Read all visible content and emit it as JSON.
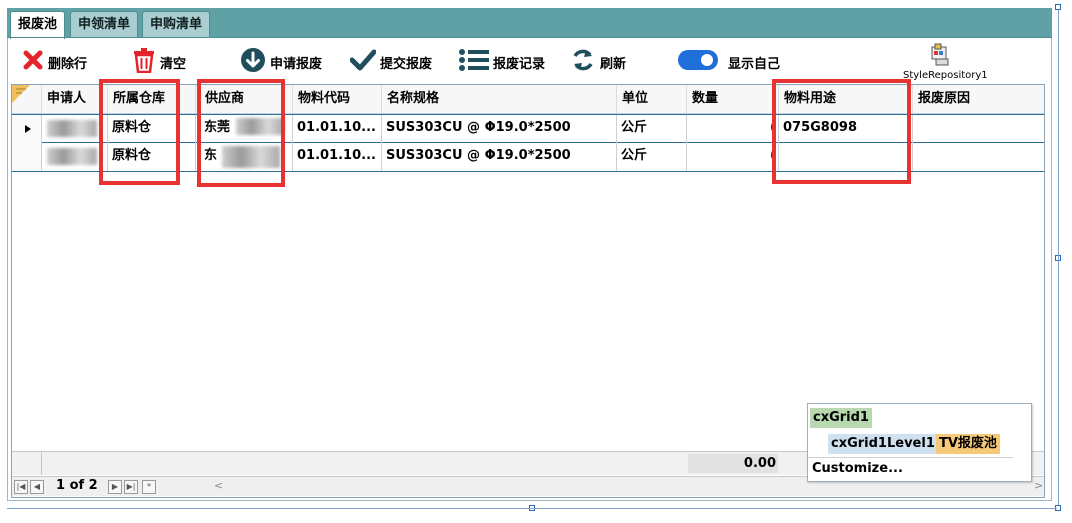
{
  "tabs": [
    {
      "label": "报废池",
      "active": true
    },
    {
      "label": "申领清单",
      "active": false
    },
    {
      "label": "申购清单",
      "active": false
    }
  ],
  "toolbar": {
    "delete_row": "删除行",
    "clear": "清空",
    "apply_scrap": "申请报废",
    "submit_scrap": "提交报废",
    "scrap_records": "报废记录",
    "refresh": "刷新",
    "show_self": "显示自己",
    "style_repository": "StyleRepository1"
  },
  "grid": {
    "columns": [
      "申请人",
      "所属仓库",
      "供应商",
      "物料代码",
      "名称规格",
      "单位",
      "数量",
      "物料用途",
      "报废原因"
    ],
    "rows": [
      {
        "applicant": "",
        "warehouse": "原料仓",
        "supplier": "东莞",
        "code": "01.01.10...",
        "spec": "SUS303CU @ Φ19.0*2500",
        "unit": "公斤",
        "qty": "(",
        "usage": "075G8098",
        "reason": ""
      },
      {
        "applicant": "",
        "warehouse": "原料仓",
        "supplier": "东",
        "code": "01.01.10...",
        "spec": "SUS303CU @ Φ19.0*2500",
        "unit": "公斤",
        "qty": "(",
        "usage": "",
        "reason": ""
      }
    ],
    "footer_sum": "0.00",
    "pager": "1 of 2"
  },
  "popup": {
    "grid_name": "cxGrid1",
    "level_name": "cxGrid1Level1",
    "view_name": "TV报废池",
    "customize": "Customize..."
  },
  "colors": {
    "tab_strip": "#5fa1a4",
    "highlight": "#e83333",
    "toggle_on": "#1e6fd9",
    "row_border": "#2d6d9a"
  }
}
